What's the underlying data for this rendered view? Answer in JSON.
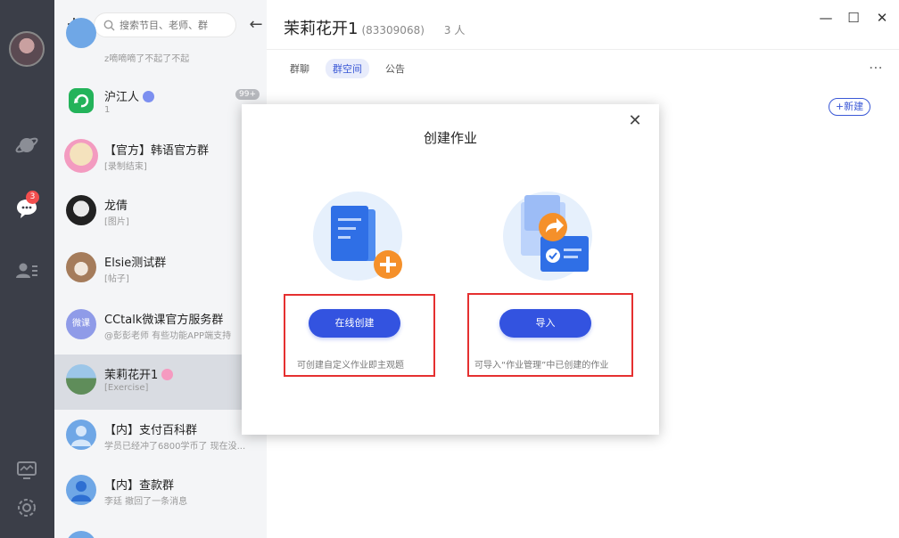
{
  "rail": {
    "unread_badge": "3"
  },
  "list": {
    "search_placeholder": "搜索节目、老师、群",
    "items": [
      {
        "name": "",
        "sub": "z嘀嘀嘀了不起了不起"
      },
      {
        "name": "沪江人",
        "sub": "1",
        "count": "99+"
      },
      {
        "name": "【官方】韩语官方群",
        "sub": "[录制结束]"
      },
      {
        "name": "龙倩",
        "sub": "[图片]"
      },
      {
        "name": "Elsie测试群",
        "sub": "[帖子]"
      },
      {
        "name": "CCtalk微课官方服务群",
        "sub": "@彭彭老师 有些功能APP端支持",
        "avatar_text": "微课"
      },
      {
        "name": "茉莉花开1",
        "sub": "[Exercise]"
      },
      {
        "name": "【内】支付百科群",
        "sub": "学员已经冲了6800学币了 现在没..."
      },
      {
        "name": "【内】查款群",
        "sub": "李廷 撤回了一条消息"
      }
    ]
  },
  "header": {
    "title": "茉莉花开1",
    "group_id": "(83309068)",
    "members": "3 人",
    "tabs": [
      "群聊",
      "群空间",
      "公告"
    ],
    "active_tab": "群空间",
    "new_button": "+新建"
  },
  "modal": {
    "title": "创建作业",
    "create_online_label": "在线创建",
    "create_online_hint": "可创建自定义作业即主观题",
    "import_label": "导入",
    "import_hint": "可导入“作业管理”中已创建的作业"
  },
  "colors": {
    "accent": "#3353e0",
    "rail": "#3b3e48",
    "highlight_box": "#e53030",
    "illustration_orange": "#f5902a"
  }
}
